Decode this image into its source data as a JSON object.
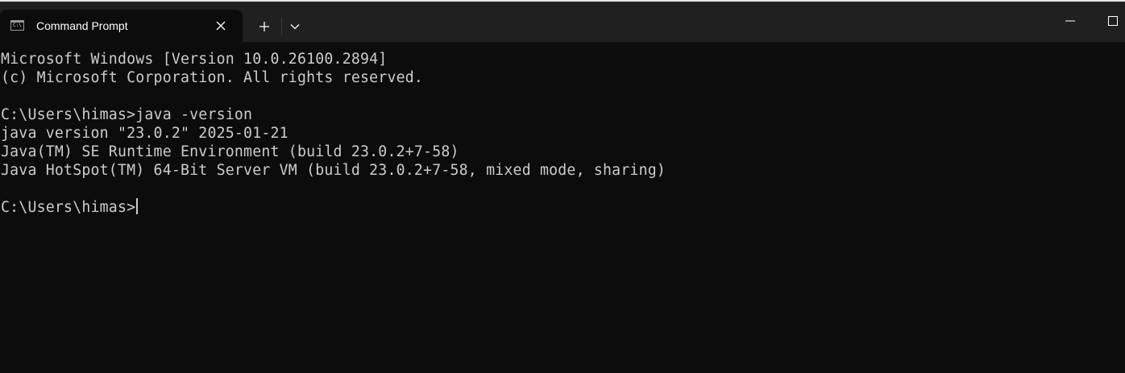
{
  "window": {
    "tab_title": "Command Prompt",
    "tab_icon_glyph": "C:\\",
    "icons": {
      "tab": "cmd-icon",
      "close": "close-icon",
      "new_tab": "plus-icon",
      "dropdown": "chevron-down-icon",
      "minimize": "minimize-icon",
      "maximize": "maximize-icon"
    }
  },
  "terminal": {
    "lines": [
      "Microsoft Windows [Version 10.0.26100.2894]",
      "(c) Microsoft Corporation. All rights reserved.",
      "",
      "C:\\Users\\himas>java -version",
      "java version \"23.0.2\" 2025-01-21",
      "Java(TM) SE Runtime Environment (build 23.0.2+7-58)",
      "Java HotSpot(TM) 64-Bit Server VM (build 23.0.2+7-58, mixed mode, sharing)",
      ""
    ],
    "prompt": "C:\\Users\\himas>"
  },
  "colors": {
    "background": "#0c0c0c",
    "titlebar": "#202020",
    "text": "#cccccc"
  }
}
